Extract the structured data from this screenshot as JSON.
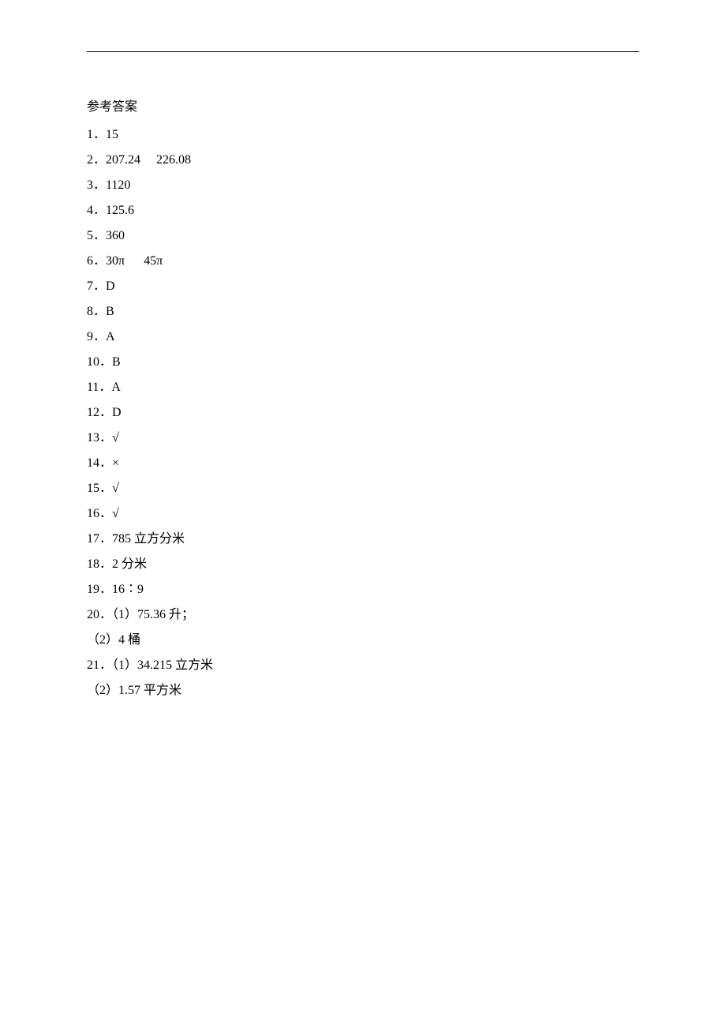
{
  "title": "参考答案",
  "answers": [
    "1．15",
    "2．207.24     226.08",
    "3．1120",
    "4．125.6",
    "5．360",
    "6．30π      45π",
    "7．D",
    "8．B",
    "9．A",
    "10．B",
    "11．A",
    "12．D",
    "13．√",
    "14．×",
    "15．√",
    "16．√",
    "17．785 立方分米",
    "18．2 分米",
    "19．16∶9",
    "20．（1）75.36 升；",
    "（2）4 桶",
    "21．（1）34.215 立方米",
    "（2）1.57 平方米"
  ]
}
